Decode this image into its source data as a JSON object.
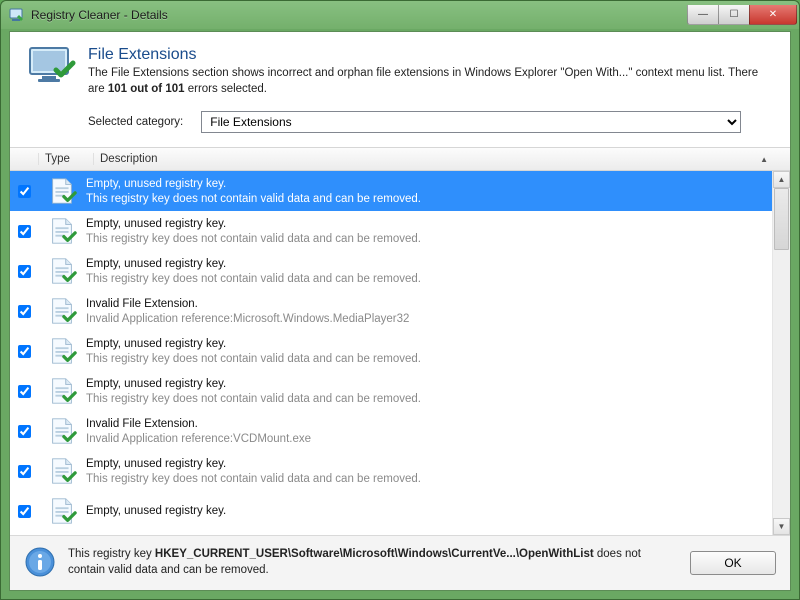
{
  "window": {
    "title": "Registry Cleaner - Details"
  },
  "header": {
    "heading": "File Extensions",
    "desc_prefix": "The File Extensions section shows incorrect and orphan file extensions in Windows Explorer \"Open With...\" context menu list. There are ",
    "desc_bold": "101 out of 101",
    "desc_suffix": " errors selected.",
    "category_label": "Selected category:",
    "category_value": "File Extensions"
  },
  "columns": {
    "type": "Type",
    "description": "Description"
  },
  "rows": [
    {
      "checked": true,
      "selected": true,
      "title": "Empty, unused registry key.",
      "sub": "This registry key does not contain valid data and can be removed."
    },
    {
      "checked": true,
      "selected": false,
      "title": "Empty, unused registry key.",
      "sub": "This registry key does not contain valid data and can be removed."
    },
    {
      "checked": true,
      "selected": false,
      "title": "Empty, unused registry key.",
      "sub": "This registry key does not contain valid data and can be removed."
    },
    {
      "checked": true,
      "selected": false,
      "title": "Invalid File Extension.",
      "sub": "Invalid Application reference:Microsoft.Windows.MediaPlayer32"
    },
    {
      "checked": true,
      "selected": false,
      "title": "Empty, unused registry key.",
      "sub": "This registry key does not contain valid data and can be removed."
    },
    {
      "checked": true,
      "selected": false,
      "title": "Empty, unused registry key.",
      "sub": "This registry key does not contain valid data and can be removed."
    },
    {
      "checked": true,
      "selected": false,
      "title": "Invalid File Extension.",
      "sub": "Invalid Application reference:VCDMount.exe"
    },
    {
      "checked": true,
      "selected": false,
      "title": "Empty, unused registry key.",
      "sub": "This registry key does not contain valid data and can be removed."
    },
    {
      "checked": true,
      "selected": false,
      "title": "Empty, unused registry key.",
      "sub": ""
    }
  ],
  "footer": {
    "prefix": "This registry key ",
    "path": "HKEY_CURRENT_USER\\Software\\Microsoft\\Windows\\CurrentVe...\\OpenWithList",
    "suffix": " does not contain valid data and can be removed.",
    "ok": "OK"
  }
}
